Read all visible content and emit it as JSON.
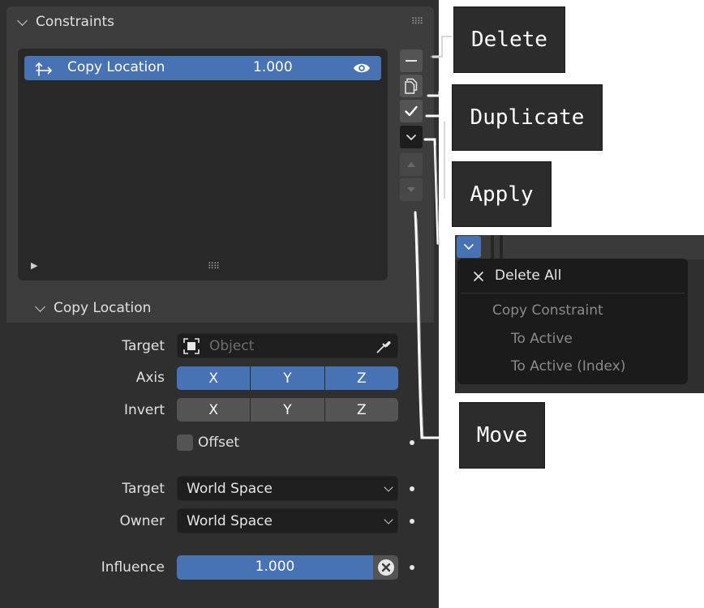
{
  "panel": {
    "title": "Constraints",
    "list": {
      "item": {
        "label": "Copy Location",
        "value": "1.000"
      }
    },
    "subpanel": {
      "title": "Copy Location",
      "target": {
        "label": "Target",
        "placeholder": "Object"
      },
      "axis": {
        "label": "Axis",
        "options": [
          "X",
          "Y",
          "Z"
        ]
      },
      "invert": {
        "label": "Invert",
        "options": [
          "X",
          "Y",
          "Z"
        ]
      },
      "offset": {
        "label": "Offset"
      },
      "target_space": {
        "label": "Target",
        "value": "World Space"
      },
      "owner_space": {
        "label": "Owner",
        "value": "World Space"
      },
      "influence": {
        "label": "Influence",
        "value": "1.000"
      }
    }
  },
  "callouts": {
    "delete": "Delete",
    "duplicate": "Duplicate",
    "apply": "Apply",
    "move": "Move"
  },
  "menu": {
    "delete_all": "Delete All",
    "copy_constraint": "Copy Constraint",
    "to_active": "To Active",
    "to_active_index": "To Active (Index)"
  },
  "colors": {
    "accent": "#4772b3",
    "panel_bg": "#3d3d3d",
    "field_bg": "#1e1e1e"
  }
}
